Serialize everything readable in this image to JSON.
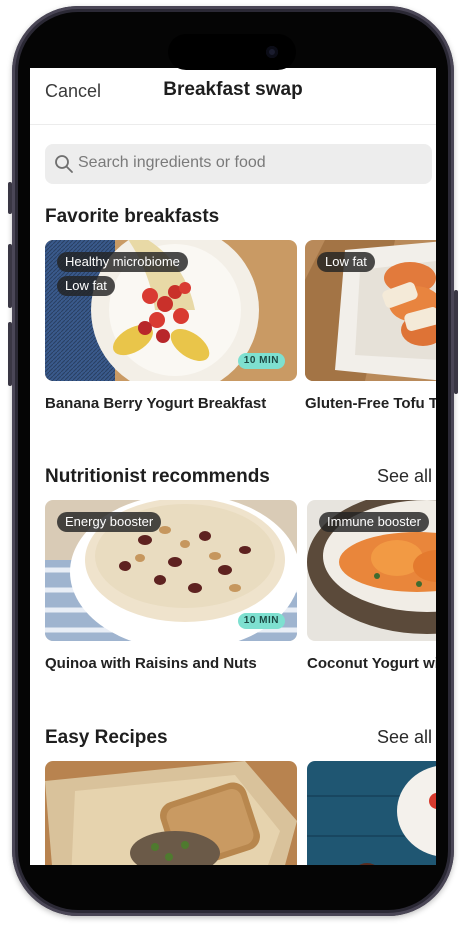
{
  "header": {
    "cancel_label": "Cancel",
    "title": "Breakfast swap"
  },
  "search": {
    "placeholder": "Search ingredients or food"
  },
  "sections": [
    {
      "title": "Favorite breakfasts",
      "see_all": "",
      "cards": [
        {
          "name": "Banana Berry Yogurt Breakfast",
          "tags": [
            "Healthy microbiome",
            "Low fat"
          ],
          "time": "10 MIN"
        },
        {
          "name": "Gluten-Free Tofu Toast",
          "tags": [
            "Low fat"
          ],
          "time": ""
        }
      ]
    },
    {
      "title": "Nutritionist recommends",
      "see_all": "See all",
      "cards": [
        {
          "name": "Quinoa with Raisins and Nuts",
          "tags": [
            "Energy booster"
          ],
          "time": "10 MIN"
        },
        {
          "name": "Coconut Yogurt with Orange",
          "tags": [
            "Immune booster"
          ],
          "time": ""
        }
      ]
    },
    {
      "title": "Easy Recipes",
      "see_all": "See all",
      "cards": [
        {
          "name": "",
          "tags": [],
          "time": ""
        },
        {
          "name": "",
          "tags": [],
          "time": ""
        }
      ]
    }
  ],
  "icons": {
    "search": "search-icon"
  },
  "colors": {
    "time_badge": "#7ee0d0",
    "tag_bg": "#232323",
    "search_bg": "#ededed"
  }
}
